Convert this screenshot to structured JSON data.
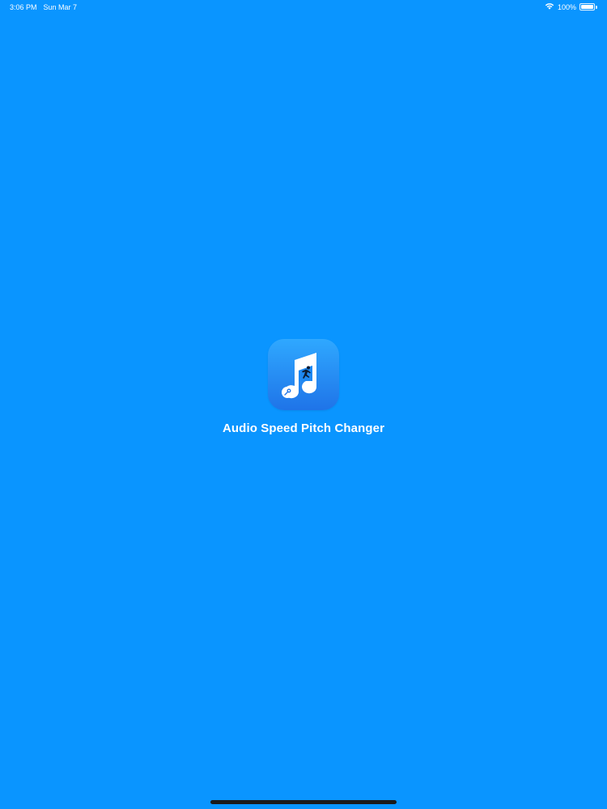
{
  "status_bar": {
    "time": "3:06 PM",
    "date": "Sun Mar 7",
    "battery_text": "100%",
    "battery_level": 1.0
  },
  "splash": {
    "app_name": "Audio Speed Pitch Changer",
    "icon": "music-note-runner-icon"
  },
  "colors": {
    "background": "#0A95FF",
    "icon_gradient_top": "#2FA8FF",
    "icon_gradient_bottom": "#1F74E8",
    "text": "#FFFFFF",
    "home_indicator": "#1A1A1A"
  }
}
